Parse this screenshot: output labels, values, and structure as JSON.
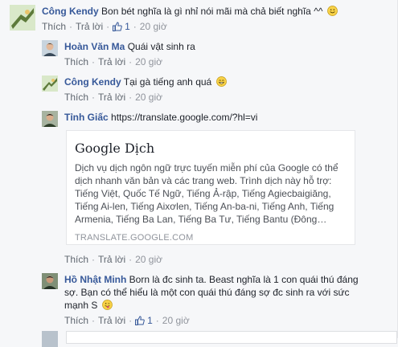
{
  "comments": [
    {
      "name": "Công Kendy",
      "text": "Bon bét nghĩa là gì nhỉ nói mãi mà chả biết nghĩa ^^",
      "like": "Thích",
      "reply": "Trả lời",
      "likes": "1",
      "time": "20 giờ"
    },
    {
      "name": "Hoàn Văn Ma",
      "text": "Quái vật sinh ra",
      "like": "Thích",
      "reply": "Trả lời",
      "time": "20 giờ"
    },
    {
      "name": "Công Kendy",
      "text": "Tại gà tiếng anh quá",
      "like": "Thích",
      "reply": "Trả lời",
      "time": "20 giờ"
    },
    {
      "name": "Tỉnh Giấc",
      "text": "https://translate.google.com/?hl=vi",
      "like": "Thích",
      "reply": "Trả lời",
      "time": "20 giờ"
    },
    {
      "name": "Hồ Nhật Minh",
      "text": "Born là đc sinh ta. Beast nghĩa là 1 con quái thú đáng sợ. Bạn có thể hiểu là một con quái thú đáng sợ đc sinh ra với sức mạnh S",
      "like": "Thích",
      "reply": "Trả lời",
      "likes": "1",
      "time": "20 giờ"
    }
  ],
  "preview": {
    "title": "Google Dịch",
    "description": "Dịch vụ dịch ngôn ngữ trực tuyến miễn phí của Google có thể dịch nhanh văn bản và các trang web. Trình dịch này hỗ trợ: Tiếng Việt, Quốc Tế Ngữ, Tiếng Ả-rập, Tiếng Agiecbaigiăng, Tiếng Ai-len, Tiếng Aixơlen, Tiếng An-ba-ni, Tiếng Anh, Tiếng Armenia, Tiếng Ba Lan, Tiếng Ba Tư, Tiếng Bantu (Đông…",
    "domain": "TRANSLATE.GOOGLE.COM"
  },
  "icons": {
    "like": "thumbs-up-icon",
    "smile": "smile-emoji-icon",
    "grin": "grin-emoji-icon",
    "tongue": "tongue-emoji-icon"
  },
  "colors": {
    "name": "#365899",
    "meta": "#90949c",
    "background": "#f6f7f9"
  }
}
